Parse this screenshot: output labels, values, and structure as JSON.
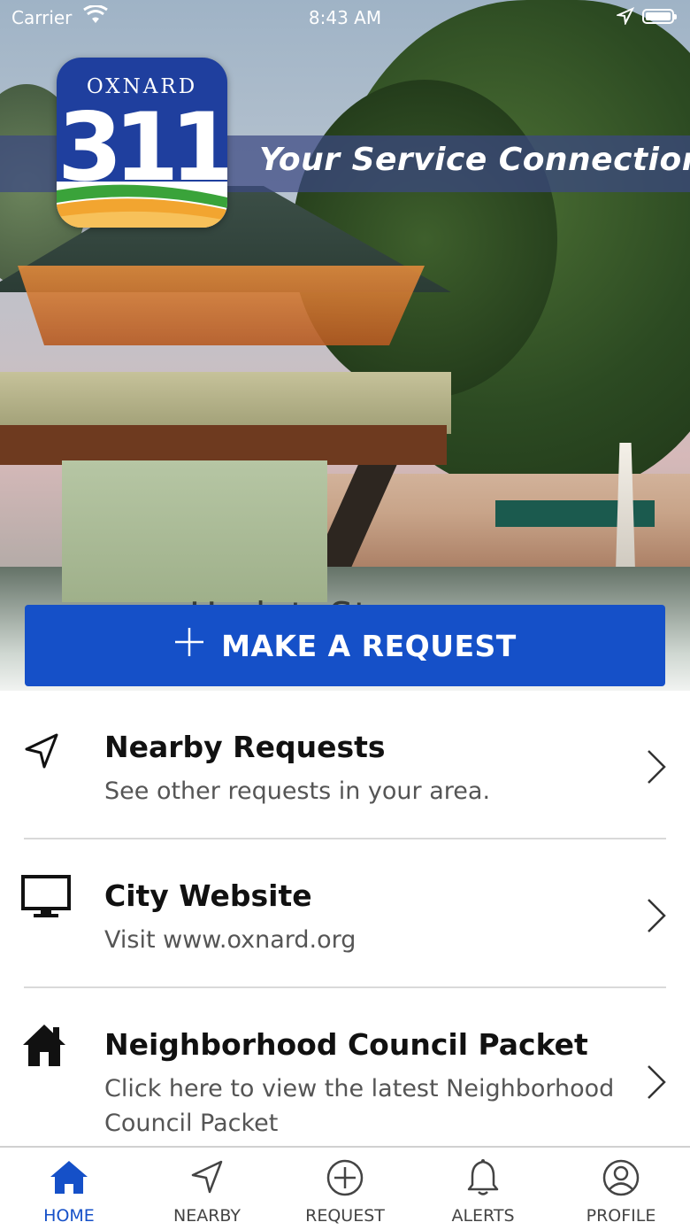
{
  "status_bar": {
    "carrier": "Carrier",
    "time": "8:43 AM",
    "icons": [
      "wifi-icon",
      "location-arrow-icon",
      "battery-icon"
    ]
  },
  "hero": {
    "logo_word": "OXNARD",
    "logo_number": "311",
    "tagline": "Your Service Connection"
  },
  "watermark": "UpdateStar.com",
  "primary_action": {
    "icon": "plus-icon",
    "label": "MAKE A REQUEST",
    "color": "#1550c8"
  },
  "menu": [
    {
      "icon": "navigation-arrow-icon",
      "title": "Nearby Requests",
      "subtitle": "See other requests in your area."
    },
    {
      "icon": "monitor-icon",
      "title": "City Website",
      "subtitle": "Visit www.oxnard.org"
    },
    {
      "icon": "house-icon",
      "title": "Neighborhood Council Packet",
      "subtitle": "Click here to view the latest Neighborhood Council Packet"
    }
  ],
  "tabs": [
    {
      "label": "HOME",
      "icon": "home-icon",
      "active": true
    },
    {
      "label": "NEARBY",
      "icon": "navigation-arrow-icon",
      "active": false
    },
    {
      "label": "REQUEST",
      "icon": "plus-circle-icon",
      "active": false
    },
    {
      "label": "ALERTS",
      "icon": "bell-icon",
      "active": false
    },
    {
      "label": "PROFILE",
      "icon": "user-circle-icon",
      "active": false
    }
  ],
  "colors": {
    "accent": "#1550c8",
    "logo_blue": "#1f3f9e"
  }
}
